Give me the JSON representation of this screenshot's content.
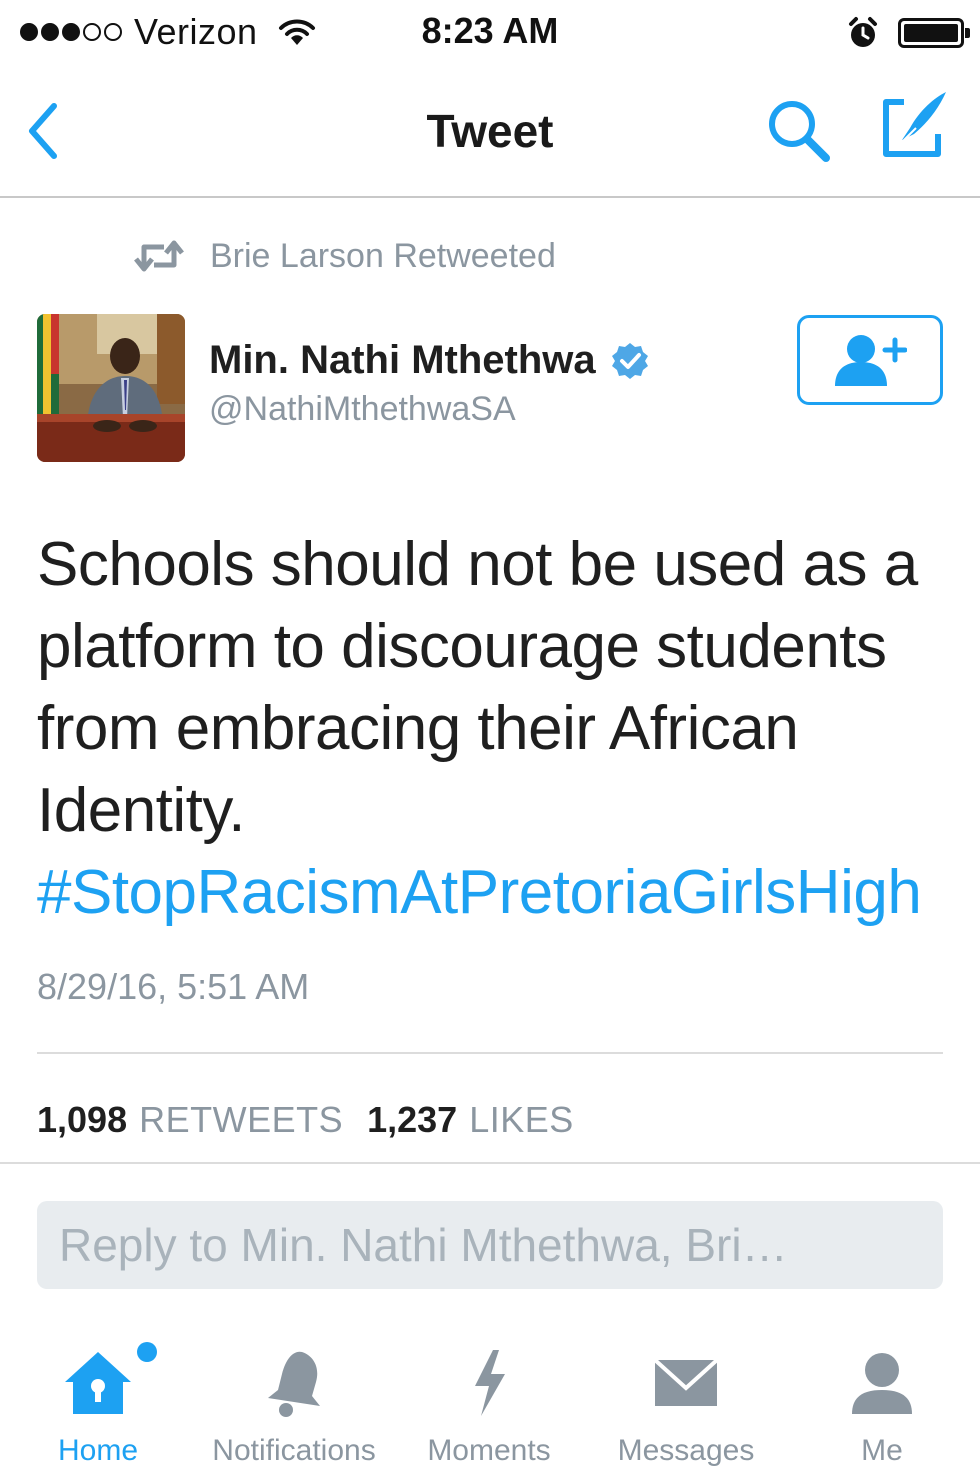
{
  "status_bar": {
    "carrier": "Verizon",
    "time": "8:23 AM",
    "signal_bars_filled": 3,
    "signal_bars_total": 5,
    "battery_level": 1.0
  },
  "nav": {
    "title": "Tweet",
    "back_icon": "chevron-left-icon",
    "search_icon": "search-icon",
    "compose_icon": "compose-icon"
  },
  "retweet_context": {
    "label": "Brie Larson Retweeted"
  },
  "author": {
    "name": "Min. Nathi Mthethwa",
    "handle": "@NathiMthethwaSA",
    "verified": true,
    "follow_icon": "follow-user-icon"
  },
  "tweet": {
    "text": "Schools should not be used as a platform to discourage students from embracing their African Identity.",
    "hashtag": "#StopRacismAtPretoriaGirlsHigh",
    "timestamp": "8/29/16, 5:51 AM"
  },
  "stats": {
    "retweets_count": "1,098",
    "retweets_label": "RETWEETS",
    "likes_count": "1,237",
    "likes_label": "LIKES"
  },
  "reply": {
    "placeholder": "Reply to Min. Nathi Mthethwa, Bri…"
  },
  "tabs": [
    {
      "label": "Home",
      "icon": "home-icon",
      "active": true,
      "has_badge": true
    },
    {
      "label": "Notifications",
      "icon": "bell-icon",
      "active": false
    },
    {
      "label": "Moments",
      "icon": "lightning-icon",
      "active": false
    },
    {
      "label": "Messages",
      "icon": "envelope-icon",
      "active": false
    },
    {
      "label": "Me",
      "icon": "person-icon",
      "active": false
    }
  ],
  "colors": {
    "accent": "#1da1f2",
    "secondary_text": "#8b96a0",
    "primary_text": "#1f1f1f",
    "reply_background": "#e8ecef"
  }
}
